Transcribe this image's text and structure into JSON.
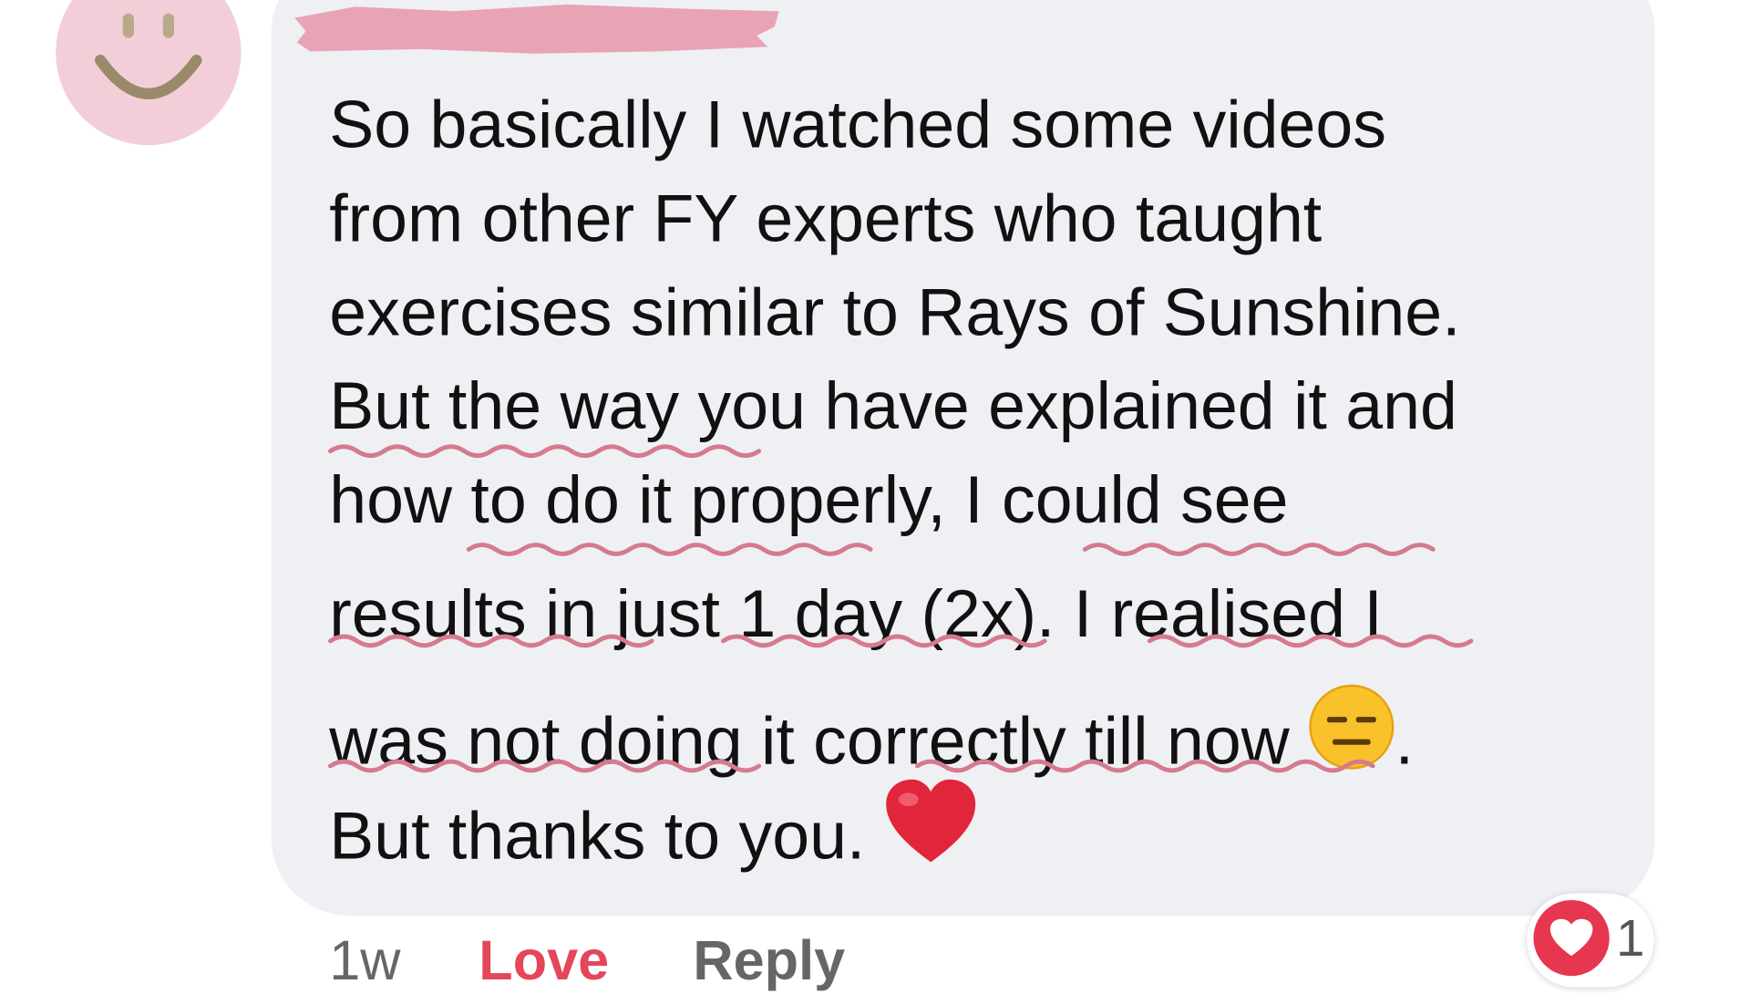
{
  "comment": {
    "lines": [
      "So basically I watched some videos",
      "from other FY experts who taught",
      "exercises similar to Rays of Sunshine.",
      "But the way you have explained it and",
      "how to do it properly, I could see",
      "results in just 1 day (2x). I realised I",
      "was not doing it correctly till now",
      "But thanks to you."
    ],
    "line7_suffix": ".",
    "emojis": {
      "expressionless": "expressionless-face-emoji",
      "heart": "red-heart-emoji"
    }
  },
  "actions": {
    "timestamp": "1w",
    "love_label": "Love",
    "reply_label": "Reply"
  },
  "reactions": {
    "icon": "heart-reaction-icon",
    "count": "1"
  },
  "colors": {
    "bubble": "#eff0f4",
    "love_active": "#e4465a",
    "spell_squiggle": "#d67a8e",
    "avatar": "#f2cfd8",
    "redaction": "#e8a3b5"
  }
}
